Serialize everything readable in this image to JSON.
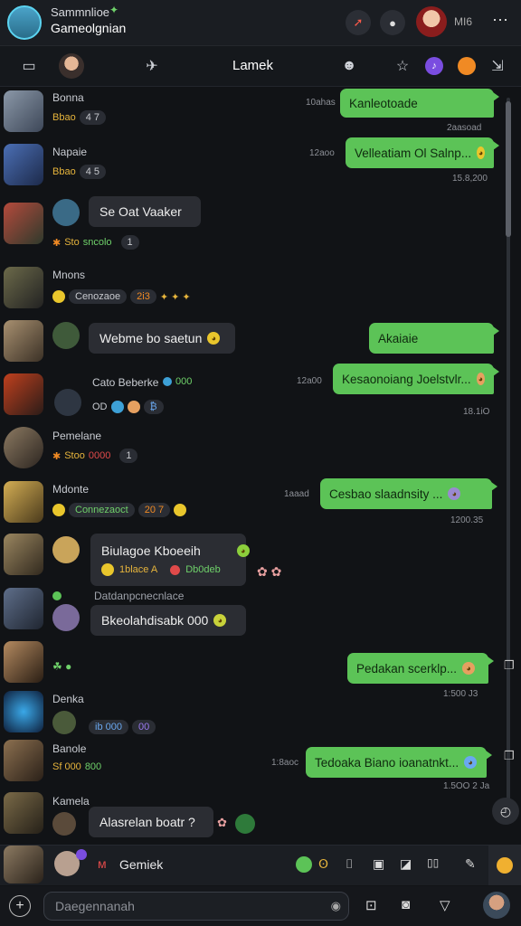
{
  "header": {
    "title": "Sammnlioe",
    "subtitle": "Gameolgnian",
    "user_label": "MI6"
  },
  "nav": {
    "title": "Lamek"
  },
  "rows": [
    {
      "name": "Bonna",
      "meta": "Bbao",
      "badge": "4 7"
    },
    {
      "name": "Napaie",
      "meta": "Bbao",
      "badge": "4 5"
    },
    {
      "message": "Se Oat Vaaker"
    },
    {
      "meta": "Sto",
      "meta2": "sncolo",
      "badge": "1"
    },
    {
      "name": "Mnons",
      "meta": "Cenozaoe",
      "badge": "2i3"
    },
    {
      "message": "Webme bo saetun"
    },
    {
      "name": "Cato Beberke",
      "meta": "000"
    },
    {
      "meta": "OD"
    },
    {
      "name": "Pemelane",
      "meta": "Stoo",
      "meta2": "0000",
      "badge": "1"
    },
    {
      "name": "Mdonte",
      "meta": "Connezaoct",
      "badge": "20 7"
    },
    {
      "message": "Biulagoe Kboeeih",
      "sub1": "1blace A",
      "sub2": "Db0deb"
    },
    {
      "name": "Datdanpcnecnlace",
      "message": "Bkeolahdisabk 000"
    },
    {
      "name": "Denka",
      "meta": "ib 000",
      "meta2": "00"
    },
    {
      "name": "Banole",
      "meta": "Sf 000",
      "meta2": "800"
    },
    {
      "name": "Kamela",
      "message": "Alasrelan boatr ?"
    }
  ],
  "outgoing": [
    {
      "text": "Kanleotoade",
      "time": "10ahas",
      "time2": "2aasoad"
    },
    {
      "text": "Velleatiam Ol Salnp...",
      "time": "12aoo",
      "time2": "15.8,200"
    },
    {
      "text": "Akaiaie",
      "time": ""
    },
    {
      "text": "Kesaonoiang Joelstvlr...",
      "time": "12a00",
      "time2": "18.1iO"
    },
    {
      "text": "Cesbao slaadnsity ...",
      "time": "1aaad",
      "time2": "1200.35"
    },
    {
      "text": "Pedakan scerklp...",
      "time": "",
      "time2": "1:500 J3"
    },
    {
      "text": "Tedoaka Biano ioanatnkt...",
      "time": "1:8aoc",
      "time2": "1.5OO 2 Ja"
    }
  ],
  "compose": {
    "name": "Gemiek"
  },
  "input": {
    "placeholder": "Daegennanah"
  },
  "colors": {
    "accent": "#5cc357",
    "background": "#111316"
  }
}
